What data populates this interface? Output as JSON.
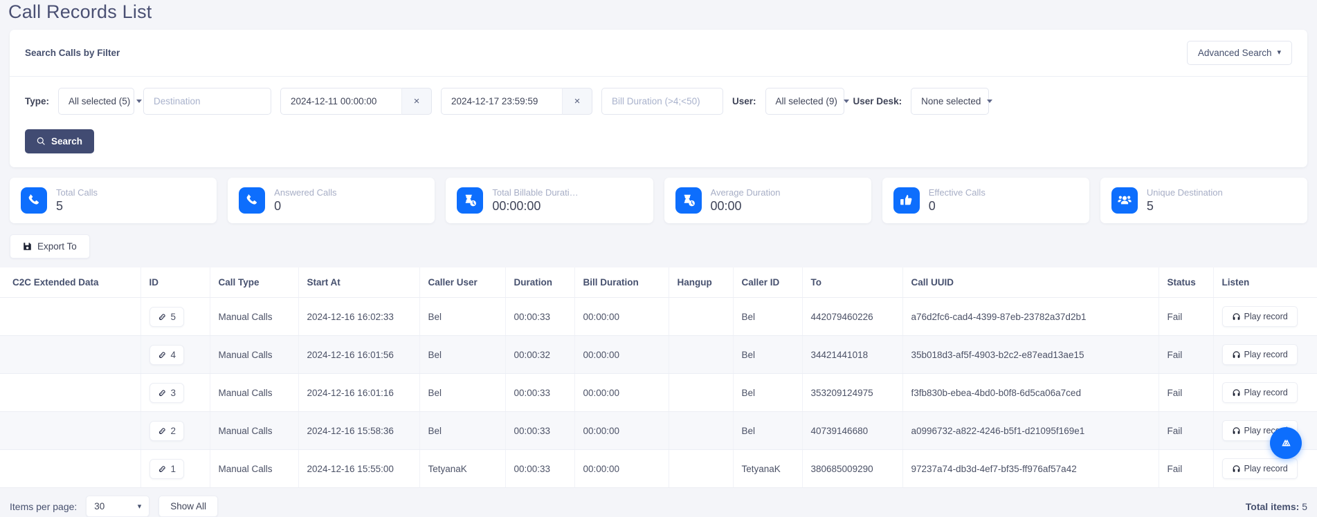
{
  "page": {
    "title": "Call Records List"
  },
  "filter": {
    "heading": "Search Calls by Filter",
    "advanced_search_label": "Advanced Search",
    "type_label": "Type:",
    "type_value": "All selected (5)",
    "destination_placeholder": "Destination",
    "date_from": "2024-12-11 00:00:00",
    "date_to": "2024-12-17 23:59:59",
    "clear_icon": "×",
    "bill_duration_placeholder": "Bill Duration (>4;<50)",
    "user_label": "User:",
    "user_value": "All selected (9)",
    "user_desk_label": "User Desk:",
    "user_desk_value": "None selected",
    "search_label": "Search"
  },
  "stats": [
    {
      "label": "Total Calls",
      "value": "5",
      "icon": "phone-icon"
    },
    {
      "label": "Answered Calls",
      "value": "0",
      "icon": "phone-icon"
    },
    {
      "label": "Total Billable Durati…",
      "value": "00:00:00",
      "icon": "hourglass-clock-icon"
    },
    {
      "label": "Average Duration",
      "value": "00:00",
      "icon": "hourglass-clock-icon"
    },
    {
      "label": "Effective Calls",
      "value": "0",
      "icon": "thumbs-up-icon"
    },
    {
      "label": "Unique Destination",
      "value": "5",
      "icon": "users-icon"
    }
  ],
  "export": {
    "label": "Export To"
  },
  "table": {
    "columns": [
      "C2C Extended Data",
      "ID",
      "Call Type",
      "Start At",
      "Caller User",
      "Duration",
      "Bill Duration",
      "Hangup",
      "Caller ID",
      "To",
      "Call UUID",
      "Status",
      "Listen"
    ],
    "play_label": "Play record",
    "rows": [
      {
        "c2c": "",
        "id": "5",
        "call_type": "Manual Calls",
        "start_at": "2024-12-16 16:02:33",
        "caller_user": "Bel",
        "duration": "00:00:33",
        "bill_duration": "00:00:00",
        "hangup": "",
        "caller_id": "Bel",
        "to": "442079460226",
        "uuid": "a76d2fc6-cad4-4399-87eb-23782a37d2b1",
        "status": "Fail"
      },
      {
        "c2c": "",
        "id": "4",
        "call_type": "Manual Calls",
        "start_at": "2024-12-16 16:01:56",
        "caller_user": "Bel",
        "duration": "00:00:32",
        "bill_duration": "00:00:00",
        "hangup": "",
        "caller_id": "Bel",
        "to": "34421441018",
        "uuid": "35b018d3-af5f-4903-b2c2-e87ead13ae15",
        "status": "Fail"
      },
      {
        "c2c": "",
        "id": "3",
        "call_type": "Manual Calls",
        "start_at": "2024-12-16 16:01:16",
        "caller_user": "Bel",
        "duration": "00:00:33",
        "bill_duration": "00:00:00",
        "hangup": "",
        "caller_id": "Bel",
        "to": "353209124975",
        "uuid": "f3fb830b-ebea-4bd0-b0f8-6d5ca06a7ced",
        "status": "Fail"
      },
      {
        "c2c": "",
        "id": "2",
        "call_type": "Manual Calls",
        "start_at": "2024-12-16 15:58:36",
        "caller_user": "Bel",
        "duration": "00:00:33",
        "bill_duration": "00:00:00",
        "hangup": "",
        "caller_id": "Bel",
        "to": "40739146680",
        "uuid": "a0996732-a822-4246-b5f1-d21095f169e1",
        "status": "Fail"
      },
      {
        "c2c": "",
        "id": "1",
        "call_type": "Manual Calls",
        "start_at": "2024-12-16 15:55:00",
        "caller_user": "TetyanaK",
        "duration": "00:00:33",
        "bill_duration": "00:00:00",
        "hangup": "",
        "caller_id": "TetyanaK",
        "to": "380685009290",
        "uuid": "97237a74-db3d-4ef7-bf35-ff976af57a42",
        "status": "Fail"
      }
    ]
  },
  "footer": {
    "items_per_page_label": "Items per page:",
    "items_per_page_value": "30",
    "show_all_label": "Show All",
    "total_items_label": "Total items:",
    "total_items_value": "5"
  },
  "colors": {
    "accent": "#0d6efd",
    "search_button": "#414b72",
    "page_bg": "#f4f5f9"
  }
}
